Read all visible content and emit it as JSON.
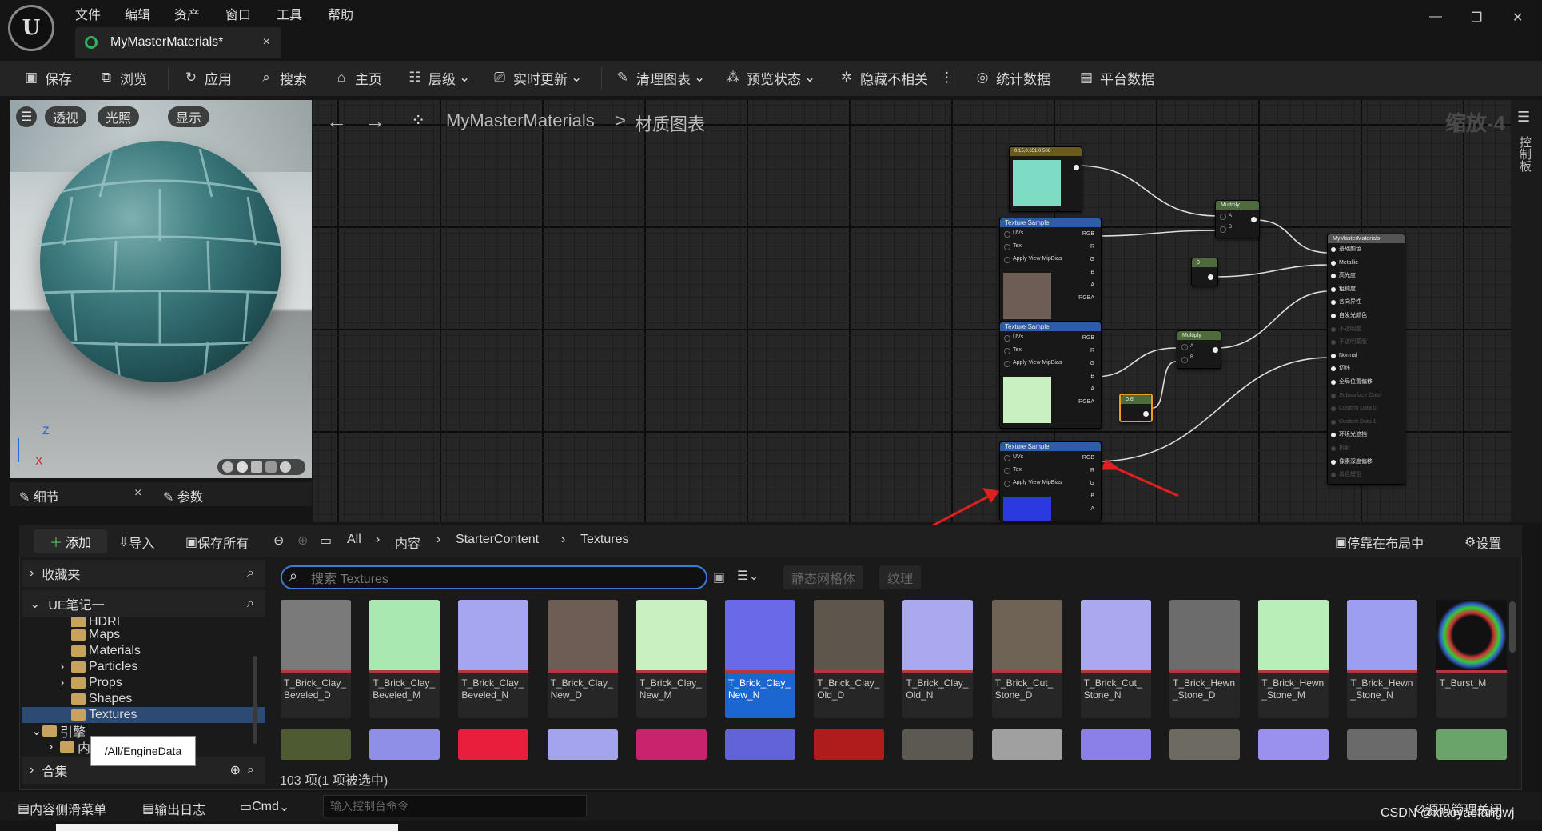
{
  "app": {
    "logo": "U",
    "doc_tab": "MyMasterMaterials*",
    "close": "×"
  },
  "menu": [
    "文件",
    "编辑",
    "资产",
    "窗口",
    "工具",
    "帮助"
  ],
  "window_controls": {
    "minimize": "—",
    "restore": "❐",
    "close": "✕"
  },
  "toolbar": [
    {
      "label": "保存",
      "icon": "save-icon"
    },
    {
      "label": "浏览",
      "icon": "browse-icon"
    },
    {
      "label": "应用",
      "icon": "apply-icon"
    },
    {
      "label": "搜索",
      "icon": "search-icon"
    },
    {
      "label": "主页",
      "icon": "home-icon"
    },
    {
      "label": "层级",
      "icon": "hierarchy-icon"
    },
    {
      "label": "实时更新",
      "icon": "live-update-icon"
    },
    {
      "label": "清理图表",
      "icon": "clean-graph-icon"
    },
    {
      "label": "预览状态",
      "icon": "preview-state-icon"
    },
    {
      "label": "隐藏不相关",
      "icon": "hide-unrelated-icon"
    },
    {
      "label": "统计数据",
      "icon": "stats-icon"
    },
    {
      "label": "平台数据",
      "icon": "platform-stats-icon"
    }
  ],
  "viewport": {
    "buttons": [
      "透视",
      "光照",
      "显示"
    ],
    "axis_z": "Z",
    "axis_x": "X"
  },
  "details": {
    "tab1": "细节",
    "tab1_close": "×",
    "tab2": "参数"
  },
  "graph": {
    "breadcrumb_root": "MyMasterMaterials",
    "breadcrumb_sep": ">",
    "breadcrumb_leaf": "材质图表",
    "zoom": "缩放-4",
    "side_label": "控制板",
    "const_node": "0.15,0.651,0.506",
    "texture_sample": "Texture Sample",
    "pins_in": [
      "UVs",
      "Tex",
      "Apply View MipBias"
    ],
    "pins_out": [
      "RGB",
      "R",
      "G",
      "B",
      "A",
      "RGBA"
    ],
    "multiply": "Multiply",
    "pin_a": "A",
    "pin_b": "B",
    "scalar1": "0",
    "scalar2": "0.6",
    "result_node": "MyMasterMaterials",
    "result_pins": [
      "基础颜色",
      "Metallic",
      "高光度",
      "粗糙度",
      "各向异性",
      "自发光颜色",
      "不透明度",
      "不透明蒙版",
      "Normal",
      "切线",
      "全局位置偏移",
      "Subsurface Color",
      "Custom Data 0",
      "Custom Data 1",
      "环境光遮挡",
      "折射",
      "像素深度偏移",
      "着色模型"
    ]
  },
  "content_browser": {
    "add": "添加",
    "import": "导入",
    "save_all": "保存所有",
    "path": [
      "All",
      "内容",
      "StarterContent",
      "Textures"
    ],
    "dock": "停靠在布局中",
    "settings": "设置",
    "favorites": "收藏夹",
    "project": "UE笔记一",
    "folders": [
      "HDRI",
      "Maps",
      "Materials",
      "Particles",
      "Props",
      "Shapes",
      "Textures"
    ],
    "engine": "引擎",
    "engine_child": "内",
    "collections": "合集",
    "search_placeholder": "搜索 Textures",
    "filters": [
      "静态网格体",
      "纹理"
    ],
    "status": "103 项(1 项被选中)",
    "tooltip": "/All/EngineData",
    "assets": [
      {
        "name": "T_Brick_Clay_Beveled_D",
        "color": "#7a7a7a"
      },
      {
        "name": "T_Brick_Clay_Beveled_M",
        "color": "#a9e8b0"
      },
      {
        "name": "T_Brick_Clay_Beveled_N",
        "color": "#a6a6f0"
      },
      {
        "name": "T_Brick_Clay_New_D",
        "color": "#6e5d55"
      },
      {
        "name": "T_Brick_Clay_New_M",
        "color": "#c8f0c0"
      },
      {
        "name": "T_Brick_Clay_New_N",
        "color": "#6a6ae8"
      },
      {
        "name": "T_Brick_Clay_Old_D",
        "color": "#5e554d"
      },
      {
        "name": "T_Brick_Clay_Old_N",
        "color": "#aaa8ee"
      },
      {
        "name": "T_Brick_Cut_Stone_D",
        "color": "#6f6356"
      },
      {
        "name": "T_Brick_Cut_Stone_N",
        "color": "#aca8f0"
      },
      {
        "name": "T_Brick_Hewn_Stone_D",
        "color": "#6c6c6c"
      },
      {
        "name": "T_Brick_Hewn_Stone_M",
        "color": "#b9eeb9"
      },
      {
        "name": "T_Brick_Hewn_Stone_N",
        "color": "#9e9ef0"
      },
      {
        "name": "T_Burst_M",
        "color": "#1a1a1a"
      }
    ],
    "row2_colors": [
      "#4e5b32",
      "#8f8fe8",
      "#e81e3c",
      "#a3a3ee",
      "#c8246e",
      "#6363d8",
      "#b01c1c",
      "#5c5852",
      "#a0a0a0",
      "#8a80e8",
      "#6d6a62",
      "#9a90ee",
      "#6a6a6a",
      "#6aa46a"
    ]
  },
  "bottombar": {
    "drawer": "内容侧滑菜单",
    "log": "输出日志",
    "cmd": "Cmd",
    "cmd_placeholder": "输入控制台命令",
    "source_control": "源码管理关闭",
    "watermark": "CSDN @xiaoyaofangwj"
  },
  "colors": {
    "accent": "#1b66d1",
    "arrow": "#e02020"
  }
}
